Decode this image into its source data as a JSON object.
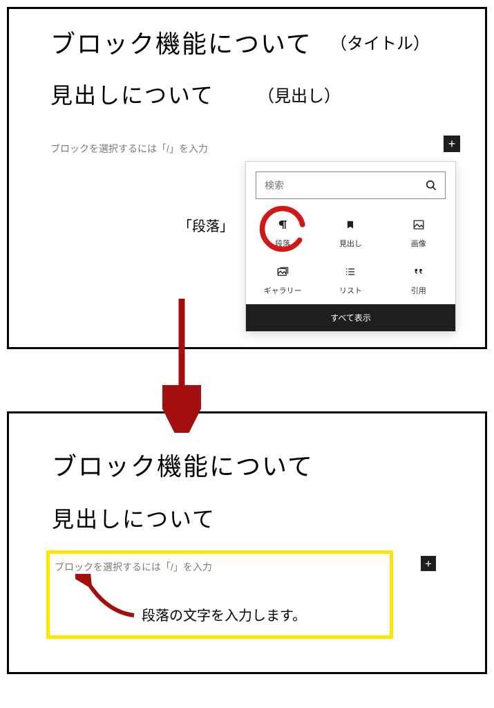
{
  "panel1": {
    "title": "ブロック機能について",
    "title_label": "（タイトル）",
    "heading": "見出しについて",
    "heading_label": "（見出し）",
    "placeholder": "ブロックを選択するには「/」を入力",
    "plus": "+",
    "annot_danraku": "「段落」"
  },
  "popup": {
    "search_placeholder": "検索",
    "blocks": {
      "paragraph": "段落",
      "heading": "見出し",
      "image": "画像",
      "gallery": "ギャラリー",
      "list": "リスト",
      "quote": "引用"
    },
    "show_all": "すべて表示"
  },
  "panel2": {
    "title": "ブロック機能について",
    "heading": "見出しについて",
    "placeholder": "ブロックを選択するには「/」を入力",
    "plus": "+",
    "caption": "段落の文字を入力します。"
  }
}
